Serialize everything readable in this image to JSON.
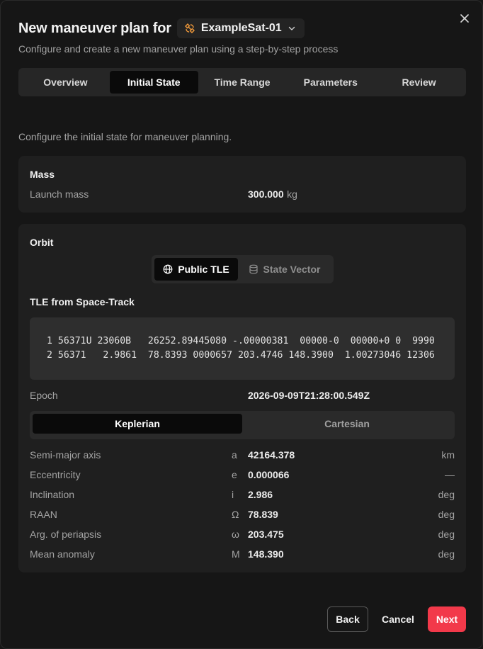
{
  "dialog": {
    "title": "New maneuver plan for",
    "satellite": "ExampleSat-01",
    "subtitle": "Configure and create a new maneuver plan using a step-by-step process",
    "close_icon": "close-icon",
    "satellite_icon": "satellite-icon",
    "chevron_icon": "chevron-down-icon"
  },
  "tabs": [
    {
      "label": "Overview",
      "active": false
    },
    {
      "label": "Initial State",
      "active": true
    },
    {
      "label": "Time Range",
      "active": false
    },
    {
      "label": "Parameters",
      "active": false
    },
    {
      "label": "Review",
      "active": false
    }
  ],
  "intro": "Configure the initial state for maneuver planning.",
  "mass": {
    "title": "Mass",
    "label": "Launch mass",
    "value": "300.000",
    "unit": "kg"
  },
  "orbit": {
    "title": "Orbit",
    "source_options": [
      {
        "label": "Public TLE",
        "icon": "globe-icon",
        "active": true
      },
      {
        "label": "State Vector",
        "icon": "database-icon",
        "active": false
      }
    ],
    "tle_title": "TLE from Space-Track",
    "tle_line1": "1 56371U 23060B   26252.89445080 -.00000381  00000-0  00000+0 0  9990",
    "tle_line2": "2 56371   2.9861  78.8393 0000657 203.4746 148.3900  1.00273046 12306",
    "epoch_label": "Epoch",
    "epoch_value": "2026-09-09T21:28:00.549Z",
    "element_types": [
      {
        "label": "Keplerian",
        "active": true
      },
      {
        "label": "Cartesian",
        "active": false
      }
    ],
    "elements": [
      {
        "label": "Semi-major axis",
        "symbol": "a",
        "value": "42164.378",
        "unit": "km"
      },
      {
        "label": "Eccentricity",
        "symbol": "e",
        "value": "0.000066",
        "unit": "—"
      },
      {
        "label": "Inclination",
        "symbol": "i",
        "value": "2.986",
        "unit": "deg"
      },
      {
        "label": "RAAN",
        "symbol": "Ω",
        "value": "78.839",
        "unit": "deg"
      },
      {
        "label": "Arg. of periapsis",
        "symbol": "ω",
        "value": "203.475",
        "unit": "deg"
      },
      {
        "label": "Mean anomaly",
        "symbol": "M",
        "value": "148.390",
        "unit": "deg"
      }
    ]
  },
  "footer": {
    "back": "Back",
    "cancel": "Cancel",
    "next": "Next"
  },
  "colors": {
    "accent": "#f2394a",
    "satellite_icon": "#f0993a",
    "background": "#161616",
    "card": "#1f1f1f"
  }
}
